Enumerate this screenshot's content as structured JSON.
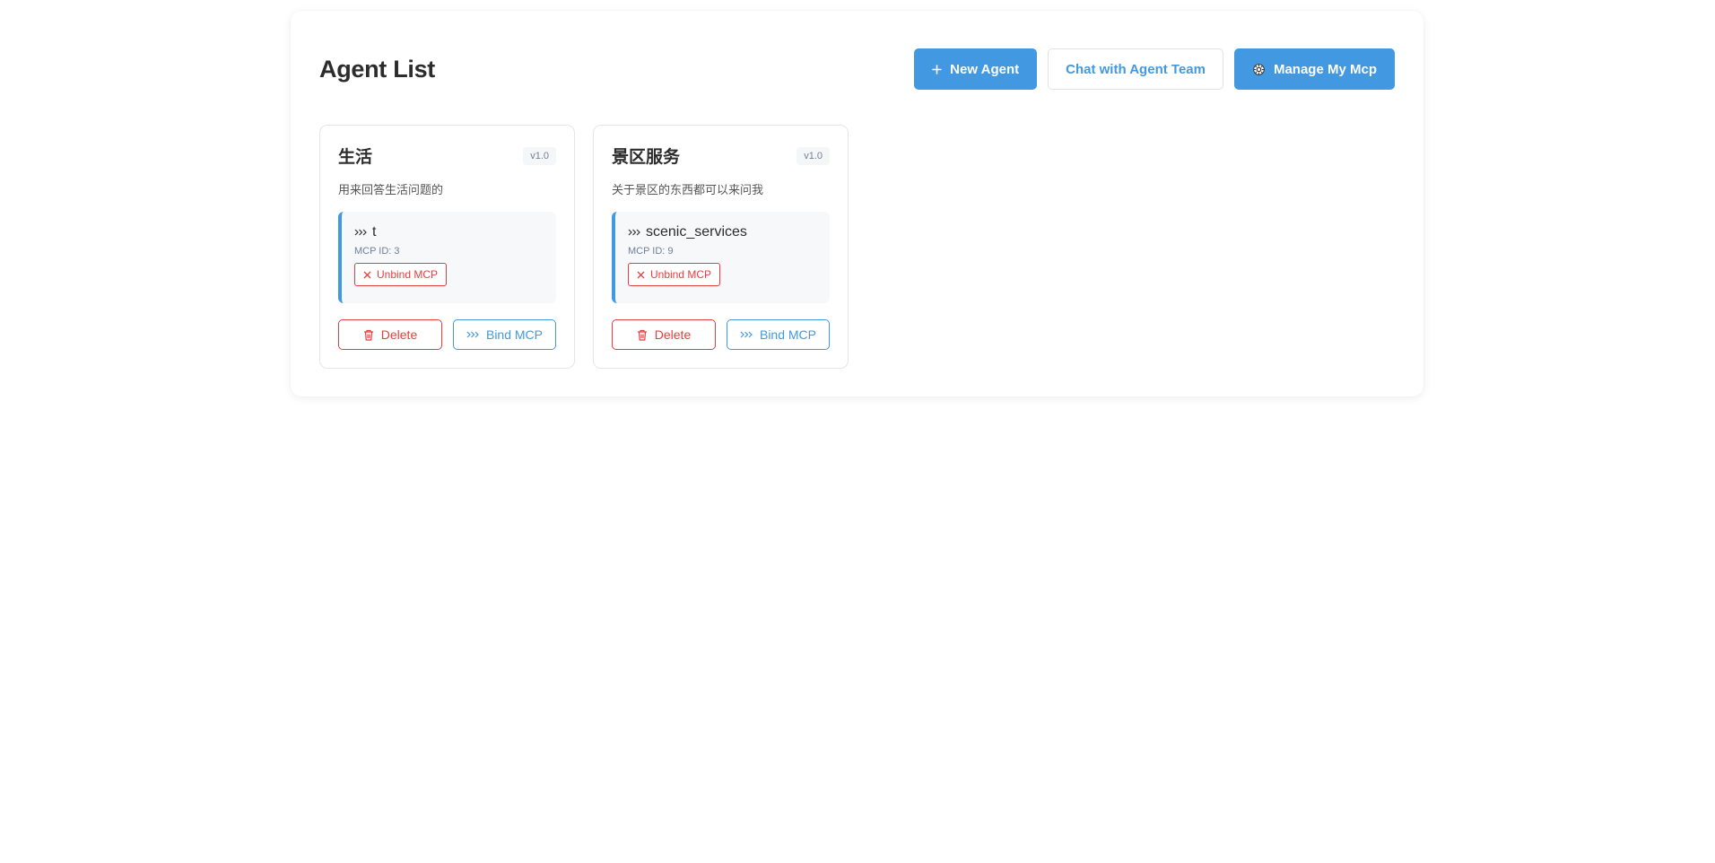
{
  "header": {
    "title": "Agent List",
    "buttons": {
      "new_agent": "New Agent",
      "new_agent_icon": "plus-icon",
      "chat_team": "Chat with Agent Team",
      "manage_mcp": "Manage My Mcp",
      "manage_mcp_icon": "gear-icon"
    }
  },
  "agents": [
    {
      "name": "生活",
      "version": "v1.0",
      "description": "用来回答生活问题的",
      "mcp": {
        "name": "t",
        "id_label": "MCP ID: 3",
        "unbind_label": "Unbind MCP"
      },
      "delete_label": "Delete",
      "bind_label": "Bind MCP"
    },
    {
      "name": "景区服务",
      "version": "v1.0",
      "description": "关于景区的东西都可以来问我",
      "mcp": {
        "name": "scenic_services",
        "id_label": "MCP ID: 9",
        "unbind_label": "Unbind MCP"
      },
      "delete_label": "Delete",
      "bind_label": "Bind MCP"
    }
  ],
  "colors": {
    "primary": "#4299e1",
    "danger": "#e53e3e",
    "text": "#2c2c2c",
    "muted": "#718096"
  }
}
